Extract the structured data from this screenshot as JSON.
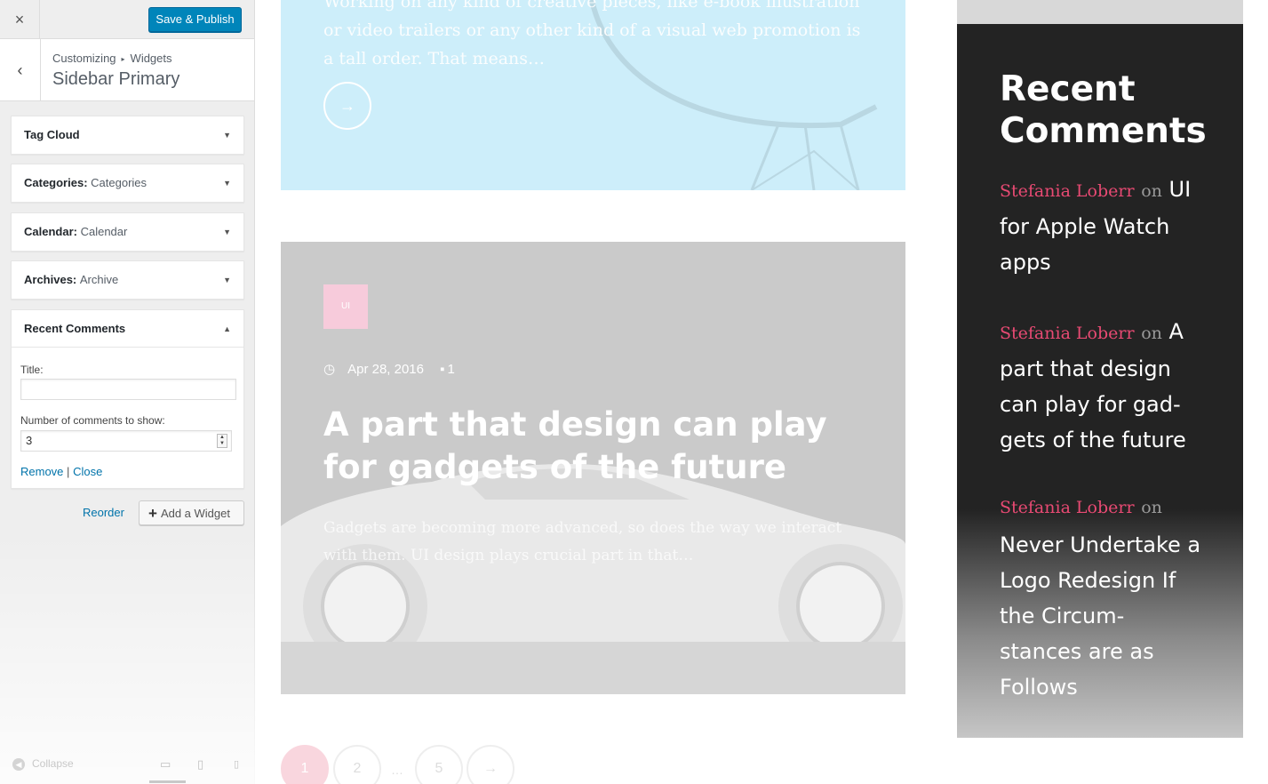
{
  "customizer": {
    "close_icon": "×",
    "save_label": "Save & Publish",
    "back_icon": "‹",
    "breadcrumb": {
      "root": "Customizing",
      "separator": "▸",
      "current": "Widgets"
    },
    "section_title": "Sidebar Primary",
    "widgets": [
      {
        "name": "Tag Cloud",
        "subtitle": ""
      },
      {
        "name": "Categories",
        "subtitle": "Categories"
      },
      {
        "name": "Calendar",
        "subtitle": "Calendar"
      },
      {
        "name": "Archives",
        "subtitle": "Archive"
      },
      {
        "name": "Recent Comments",
        "subtitle": ""
      }
    ],
    "recent_comments_form": {
      "title_label": "Title:",
      "title_value": "",
      "number_label": "Number of comments to show:",
      "number_value": "3",
      "remove_label": "Remove",
      "link_separator": "|",
      "close_label": "Close"
    },
    "reorder_label": "Reorder",
    "add_widget_label": "Add a Widget",
    "collapse_label": "Collapse",
    "colors": {
      "primary_button": "#0085ba",
      "link": "#0073aa"
    }
  },
  "preview": {
    "post1": {
      "excerpt": "Working on any kind of creative pieces, like e-book illustration or video trailers or any other kind of a visual web promotion is a tall order. That means…",
      "arrow_icon": "→"
    },
    "post2": {
      "category": "UI",
      "date": "Apr 28, 2016",
      "comment_count": "1",
      "title": "A part that design can play for gadgets of the future",
      "excerpt": "Gadgets are becoming more advanced, so does the way we interact with them. UI design plays crucial part in that…"
    },
    "pagination": [
      "1",
      "2",
      "…",
      "5",
      "→"
    ],
    "sidebar_widget": {
      "title": "Recent Comments",
      "connector": "on",
      "comments": [
        {
          "author": "Stefania Loberr",
          "post": "UI for Apple Watch apps"
        },
        {
          "author": "Stefania Loberr",
          "post": "A part that design can play for gad-gets of the future"
        },
        {
          "author": "Stefania Loberr",
          "post": "Never Undertake a Logo Redesign If the Circum-stances are as Follows"
        }
      ],
      "colors": {
        "background": "#232323",
        "author": "#e84a73"
      }
    }
  }
}
